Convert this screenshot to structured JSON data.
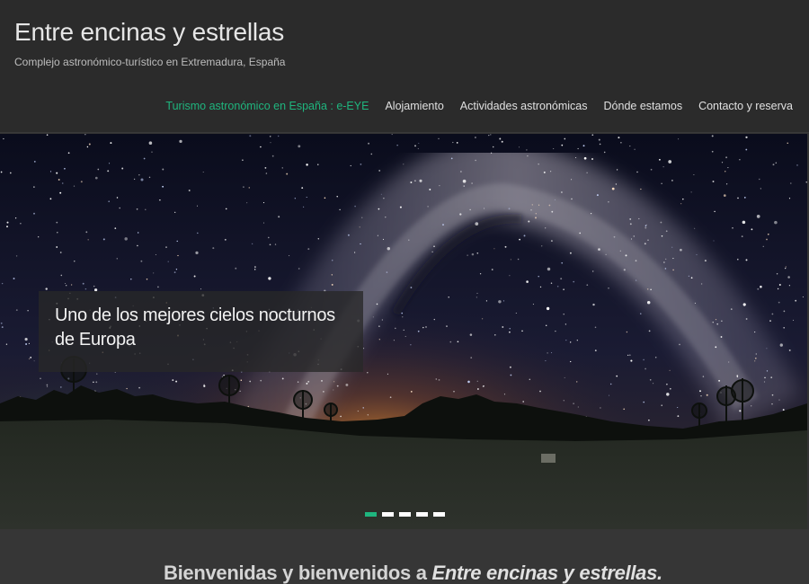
{
  "header": {
    "site_title": "Entre encinas y estrellas",
    "tagline": "Complejo astronómico-turístico en Extremadura, España"
  },
  "nav": {
    "items": [
      {
        "label": "Turismo astronómico en España : e-EYE",
        "active": true
      },
      {
        "label": "Alojamiento",
        "active": false
      },
      {
        "label": "Actividades astronómicas",
        "active": false
      },
      {
        "label": "Dónde estamos",
        "active": false
      },
      {
        "label": "Contacto y reserva",
        "active": false
      }
    ],
    "active_color": "#1fb57e"
  },
  "hero": {
    "caption": "Uno de los mejores cielos nocturnos de Europa",
    "slides_total": 5,
    "active_slide": 1
  },
  "welcome": {
    "prefix": "Bienvenidas y bienvenidos a ",
    "emphasis": "Entre encinas y estrellas."
  }
}
